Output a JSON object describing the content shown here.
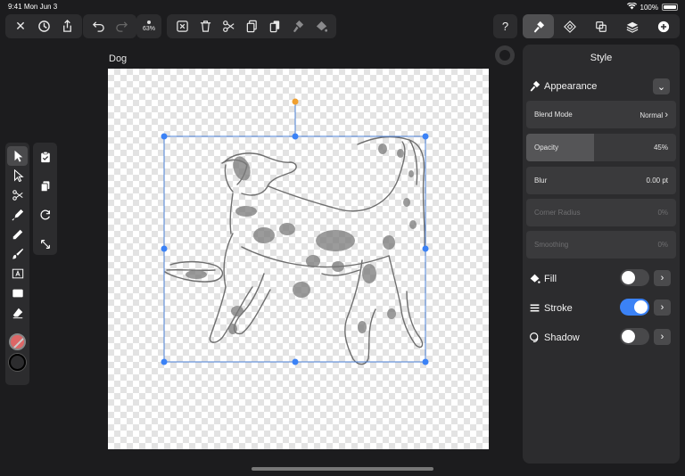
{
  "status": {
    "time": "9:41",
    "date": "Mon Jun 3",
    "battery": "100%"
  },
  "toolbar": {
    "zoom": "63%",
    "icons": [
      "close-icon",
      "history-icon",
      "share-icon",
      "undo-icon",
      "redo-icon",
      "deselect-icon",
      "trash-icon",
      "scissors-icon",
      "copy-icon",
      "paste-icon",
      "paint-format-icon",
      "paint-bucket-icon"
    ]
  },
  "document": {
    "title": "Dog"
  },
  "inspector": {
    "help_label": "?",
    "tabs": [
      "style-icon",
      "arrange-icon",
      "boolean-icon",
      "layers-icon",
      "add-icon"
    ],
    "title": "Style",
    "appearance": "Appearance",
    "rows": [
      {
        "label": "Blend Mode",
        "value": "Normal"
      },
      {
        "label": "Opacity",
        "value": "45%",
        "fill": 0.45
      },
      {
        "label": "Blur",
        "value": "0.00 pt"
      },
      {
        "label": "Corner Radius",
        "value": "0%"
      },
      {
        "label": "Smoothing",
        "value": "0%"
      }
    ],
    "fill": {
      "label": "Fill",
      "on": false
    },
    "stroke": {
      "label": "Stroke",
      "on": true
    },
    "shadow": {
      "label": "Shadow",
      "on": false
    },
    "accent": "#3b82f6"
  }
}
